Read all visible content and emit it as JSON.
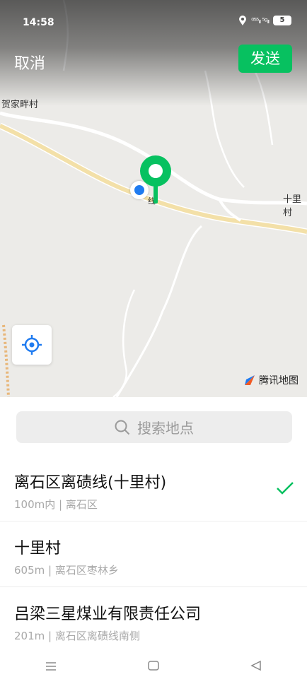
{
  "status_bar": {
    "time": "14:58",
    "signal_text": "⁰⁵⁵ᵢₗₗ ⁵ᵍᵢₗₗ",
    "battery": "5"
  },
  "header": {
    "cancel_label": "取消",
    "send_label": "发送"
  },
  "map": {
    "labels": {
      "village_left": "贺家畔村",
      "village_right": "十里村",
      "road_tag": "线"
    },
    "logo_text": "腾讯地图",
    "colors": {
      "pin": "#07c160",
      "location": "#1f7bf0",
      "road": "#f3e0a8"
    }
  },
  "search": {
    "placeholder": "搜索地点"
  },
  "results": [
    {
      "title": "离石区离碛线(十里村)",
      "subtitle": "100m内 | 离石区",
      "selected": true
    },
    {
      "title": "十里村",
      "subtitle": "605m | 离石区枣林乡",
      "selected": false
    },
    {
      "title": "吕梁三星煤业有限责任公司",
      "subtitle": "201m | 离石区离碛线南侧",
      "selected": false
    }
  ],
  "nav": {
    "menu_icon": "menu-icon",
    "home_icon": "home-icon",
    "back_icon": "back-icon"
  }
}
